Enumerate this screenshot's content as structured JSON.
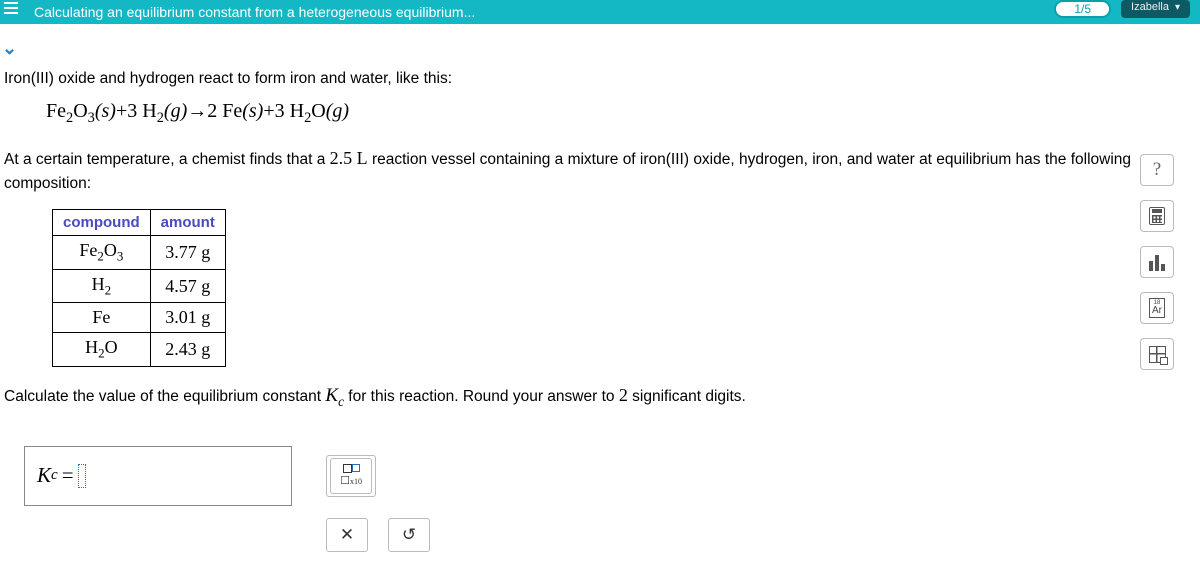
{
  "header": {
    "title": "Calculating an equilibrium constant from a heterogeneous equilibrium...",
    "progress": "1/5",
    "user": "Izabella"
  },
  "prompt": {
    "line1": "Iron(III) oxide and hydrogen react to form iron and water, like this:",
    "line2_a": "At a certain temperature, a chemist finds that a ",
    "line2_vol": "2.5 L",
    "line2_b": " reaction vessel containing a mixture of iron(III) oxide, hydrogen, iron, and water at equilibrium has the following composition:",
    "line3_a": "Calculate the value of the equilibrium constant ",
    "line3_b": " for this reaction. Round your answer to ",
    "line3_sig": "2",
    "line3_c": " significant digits."
  },
  "equation": {
    "lhs1": "Fe",
    "lhs1s1": "2",
    "lhs1o": "O",
    "lhs1s2": "3",
    "lhs1ph": "(s)",
    "plus1": "+",
    "coef2": "3 ",
    "lhs2": "H",
    "lhs2s": "2",
    "lhs2ph": "(g)",
    "arrow": "→",
    "coef3": "2 ",
    "rhs1": "Fe",
    "rhs1ph": "(s)",
    "plus2": "+",
    "coef4": "3 ",
    "rhs2": "H",
    "rhs2s": "2",
    "rhs2o": "O",
    "rhs2ph": "(g)"
  },
  "table": {
    "h1": "compound",
    "h2": "amount",
    "rows": [
      {
        "c": "Fe₂O₃",
        "a": "3.77 g"
      },
      {
        "c": "H₂",
        "a": "4.57 g"
      },
      {
        "c": "Fe",
        "a": "3.01 g"
      },
      {
        "c": "H₂O",
        "a": "2.43 g"
      }
    ]
  },
  "answer": {
    "label": "K",
    "sub": "c",
    "eq": " = "
  },
  "tools": {
    "sci_exp": "x10",
    "clear": "✕",
    "reset": "↺"
  }
}
